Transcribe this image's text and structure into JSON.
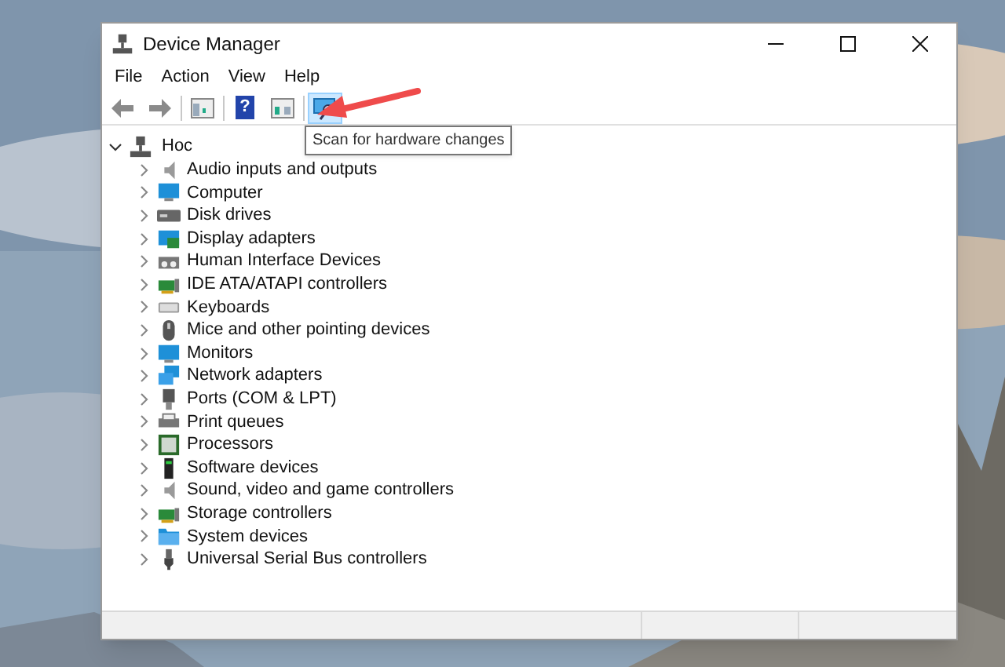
{
  "window": {
    "title": "Device Manager"
  },
  "menu": [
    "File",
    "Action",
    "View",
    "Help"
  ],
  "toolbar": [
    {
      "kind": "back",
      "hovered": false
    },
    {
      "kind": "forward",
      "hovered": false
    },
    {
      "kind": "console",
      "hovered": false
    },
    {
      "kind": "help",
      "label": "?",
      "hovered": false
    },
    {
      "kind": "properties",
      "hovered": false
    },
    {
      "kind": "scan",
      "hovered": true
    }
  ],
  "tooltip": "Scan for hardware changes",
  "tree": {
    "label": "Hoc",
    "expanded": true,
    "children": [
      {
        "label": "Audio inputs and outputs",
        "kind": "speaker",
        "expanded": false
      },
      {
        "label": "Computer",
        "kind": "monitor",
        "expanded": false
      },
      {
        "label": "Disk drives",
        "kind": "disk",
        "expanded": false
      },
      {
        "label": "Display adapters",
        "kind": "display",
        "expanded": false
      },
      {
        "label": "Human Interface Devices",
        "kind": "hid",
        "expanded": false
      },
      {
        "label": "IDE ATA/ATAPI controllers",
        "kind": "card",
        "expanded": false
      },
      {
        "label": "Keyboards",
        "kind": "keyboard",
        "expanded": false
      },
      {
        "label": "Mice and other pointing devices",
        "kind": "mouse",
        "expanded": false
      },
      {
        "label": "Monitors",
        "kind": "monitor",
        "expanded": false
      },
      {
        "label": "Network adapters",
        "kind": "network",
        "expanded": false
      },
      {
        "label": "Ports (COM & LPT)",
        "kind": "port",
        "expanded": false
      },
      {
        "label": "Print queues",
        "kind": "printer",
        "expanded": false
      },
      {
        "label": "Processors",
        "kind": "chip",
        "expanded": false
      },
      {
        "label": "Software devices",
        "kind": "tower",
        "expanded": false
      },
      {
        "label": "Sound, video and game controllers",
        "kind": "speaker",
        "expanded": false
      },
      {
        "label": "Storage controllers",
        "kind": "card",
        "expanded": false
      },
      {
        "label": "System devices",
        "kind": "folder",
        "expanded": false
      },
      {
        "label": "Universal Serial Bus controllers",
        "kind": "usb",
        "expanded": false
      }
    ]
  }
}
